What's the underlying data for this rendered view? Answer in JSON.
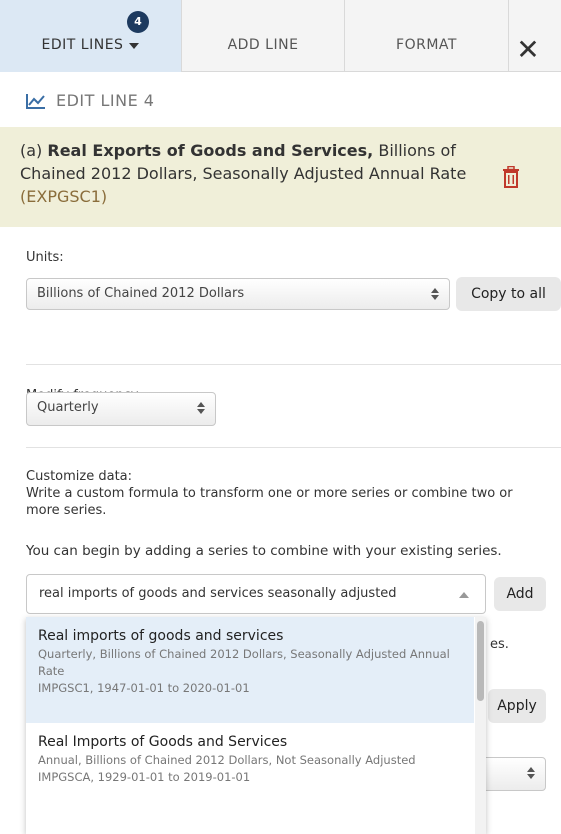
{
  "tabs": {
    "edit_lines": "EDIT LINES",
    "edit_lines_badge": "4",
    "add_line": "ADD LINE",
    "format": "FORMAT",
    "close": "✕"
  },
  "edit_heading": "EDIT LINE 4",
  "series": {
    "prefix": "(a) ",
    "name": "Real Exports of Goods and Services,",
    "desc": " Billions of Chained 2012 Dollars, Seasonally Adjusted Annual Rate ",
    "code": "(EXPGSC1)"
  },
  "units": {
    "label": "Units:",
    "value": "Billions of Chained 2012 Dollars",
    "copy_button": "Copy to all"
  },
  "frequency": {
    "label": "Modify frequency:",
    "value": "Quarterly"
  },
  "customize": {
    "label": "Customize data:",
    "help": "Write a custom formula to transform one or more series or combine two or more series.",
    "hint": "You can begin by adding a series to combine with your existing series."
  },
  "search": {
    "value": "real imports of goods and services seasonally adjusted",
    "add_button": "Add"
  },
  "dropdown": {
    "items": [
      {
        "title": "Real imports of goods and services",
        "desc": "Quarterly, Billions of Chained 2012 Dollars, Seasonally Adjusted Annual Rate",
        "meta": "IMPGSC1, 1947-01-01 to 2020-01-01"
      },
      {
        "title": "Real Imports of Goods and Services",
        "desc": "Annual, Billions of Chained 2012 Dollars, Not Seasonally Adjusted",
        "meta": "IMPGSCA, 1929-01-01 to 2019-01-01"
      }
    ]
  },
  "behind": {
    "partial_text": "es.",
    "apply_button": "Apply"
  },
  "colors": {
    "active_tab": "#dce8f4",
    "series_box": "#f0efd9",
    "trash": "#c0392b",
    "badge": "#1d3a5f",
    "highlight": "#e4eef8"
  }
}
